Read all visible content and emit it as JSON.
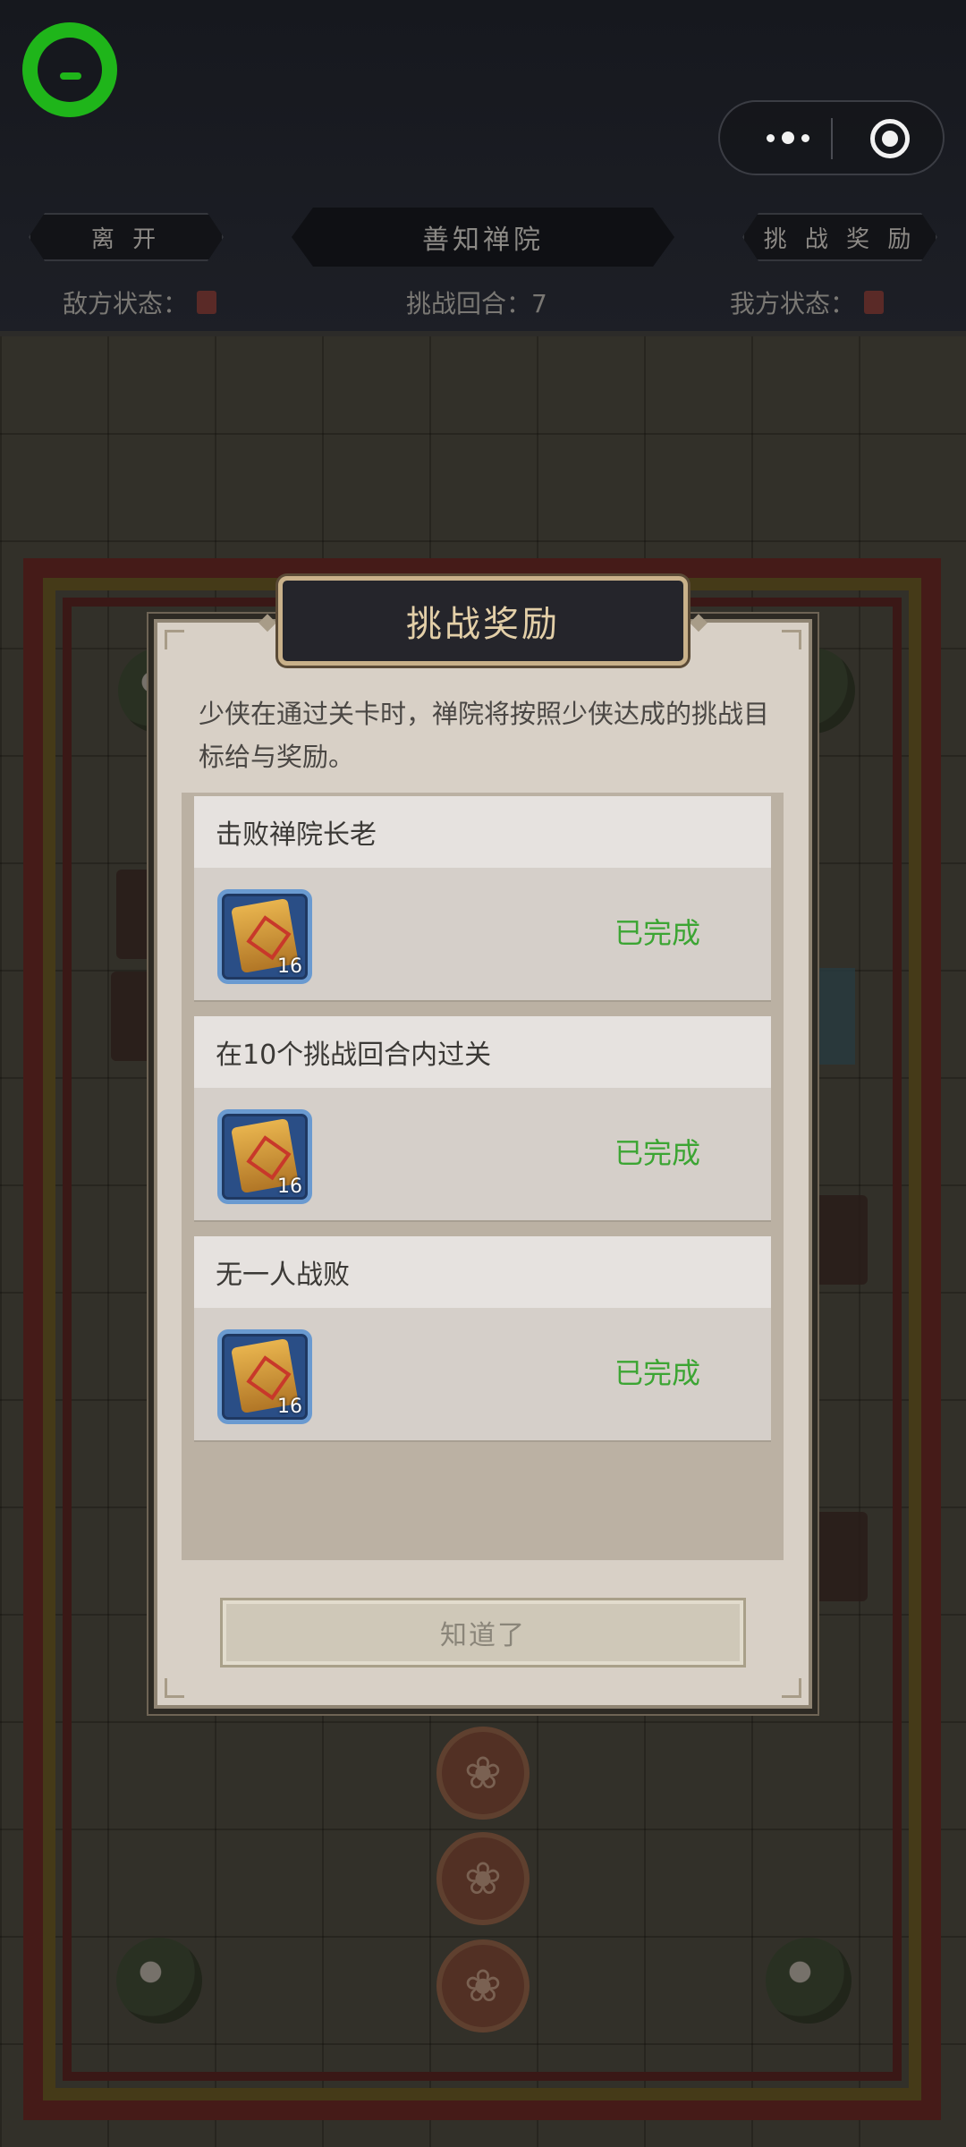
{
  "header": {
    "leave_label": "离 开",
    "title": "善知禅院",
    "reward_label": "挑 战 奖 励",
    "enemy_status_label": "敌方状态：",
    "round_label": "挑战回合：7",
    "my_status_label": "我方状态："
  },
  "modal": {
    "title": "挑战奖励",
    "intro": "少侠在通过关卡时，禅院将按照少侠达成的挑战目标给与奖励。",
    "tasks": [
      {
        "name": "击败禅院长老",
        "reward_qty": "16",
        "status": "已完成"
      },
      {
        "name": "在10个挑战回合内过关",
        "reward_qty": "16",
        "status": "已完成"
      },
      {
        "name": "无一人战败",
        "reward_qty": "16",
        "status": "已完成"
      }
    ],
    "confirm_label": "知道了"
  },
  "colors": {
    "status_done": "#3ca533",
    "app_logo": "#1fb51a",
    "title_text": "#e3cfa8"
  },
  "icons": {
    "app_logo": "chat-logo-icon",
    "more": "more-dots-icon",
    "close": "target-close-icon",
    "reward_item": "gift-package-icon"
  }
}
